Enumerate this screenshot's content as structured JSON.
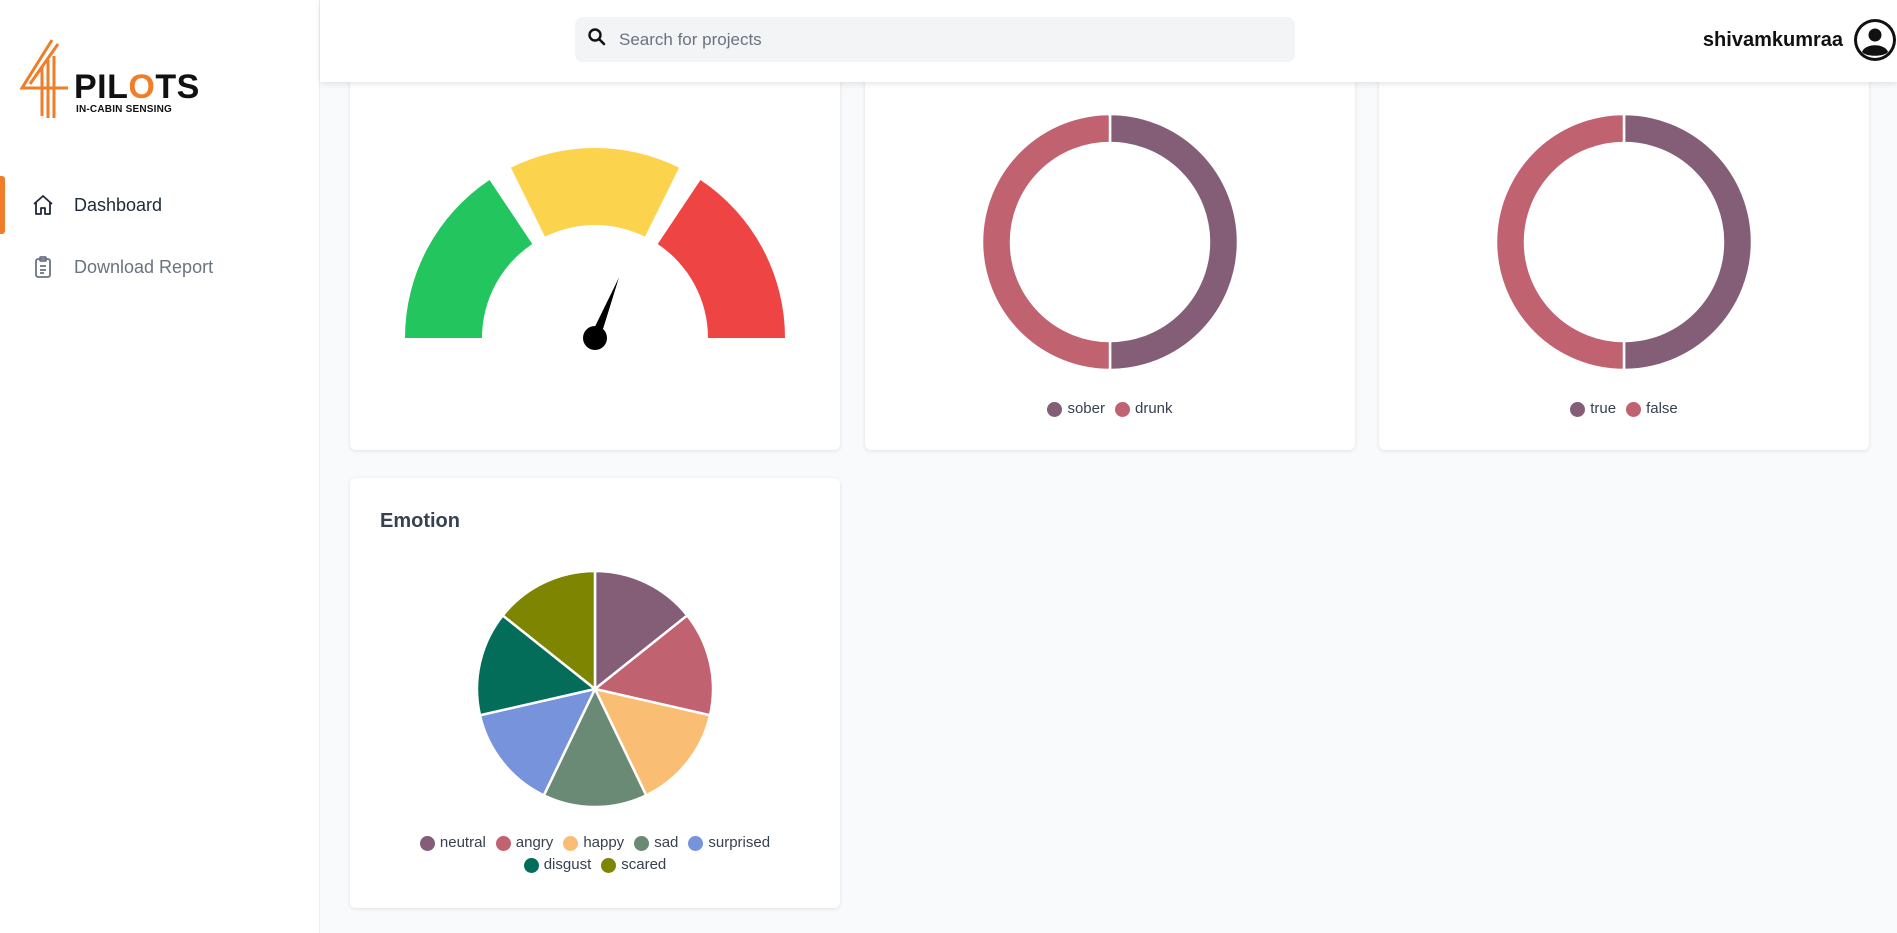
{
  "sidebar": {
    "logo": {
      "brand_prefix": "PIL",
      "brand_o": "O",
      "brand_suffix": "TS",
      "tagline": "IN-CABIN SENSING"
    },
    "items": [
      {
        "label": "Dashboard",
        "icon": "home-icon",
        "active": true
      },
      {
        "label": "Download Report",
        "icon": "clipboard-icon",
        "active": false
      }
    ]
  },
  "header": {
    "search": {
      "placeholder": "Search for projects",
      "value": ""
    },
    "username": "shivamkumraa",
    "avatar_icon": "user-avatar-icon"
  },
  "colors": {
    "accent": "#ef7d2a",
    "gauge_green": "#22c55e",
    "gauge_yellow": "#fcd34d",
    "gauge_red": "#ef4444"
  },
  "gauge": {
    "value_fraction": 0.62
  },
  "chart_data": [
    {
      "type": "pie",
      "variant": "doughnut",
      "title": "",
      "labels": [
        "sober",
        "drunk"
      ],
      "values": [
        50,
        50
      ],
      "colors": [
        "#845e77",
        "#c16270"
      ],
      "legend": "bottom"
    },
    {
      "type": "pie",
      "variant": "doughnut",
      "title": "",
      "labels": [
        "true",
        "false"
      ],
      "values": [
        50,
        50
      ],
      "colors": [
        "#845e77",
        "#c16270"
      ],
      "legend": "bottom"
    },
    {
      "type": "pie",
      "title": "Emotion",
      "labels": [
        "neutral",
        "angry",
        "happy",
        "sad",
        "surprised",
        "disgust",
        "scared"
      ],
      "values": [
        1,
        1,
        1,
        1,
        1,
        1,
        1
      ],
      "colors": [
        "#845e77",
        "#c16270",
        "#f9be74",
        "#6b8a75",
        "#7793db",
        "#046d59",
        "#7e8601"
      ],
      "legend": "bottom"
    }
  ]
}
